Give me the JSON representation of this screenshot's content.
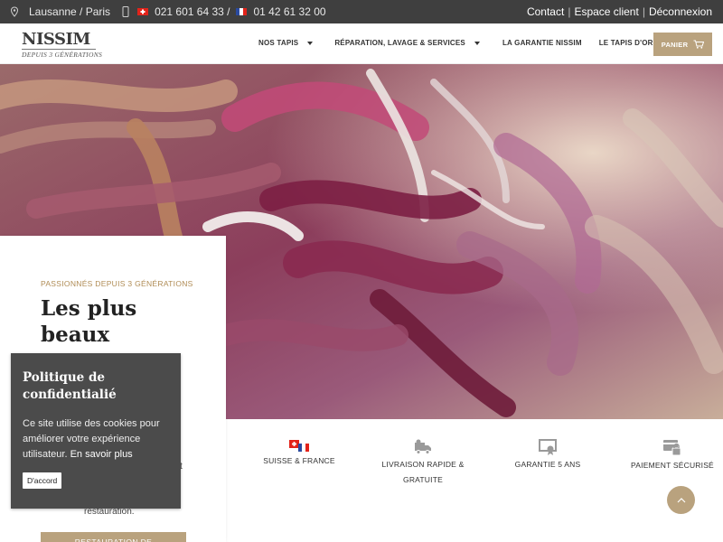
{
  "topbar": {
    "location": "Lausanne / Paris",
    "phone_ch": "021 601 64 33 /",
    "phone_fr": "01 42 61 32 00",
    "links": [
      "Contact",
      "Espace client",
      "Déconnexion"
    ]
  },
  "header": {
    "logo_brand": "NISSIM",
    "logo_sub": "DEPUIS 3 GÉNÉRATIONS",
    "nav": [
      {
        "label": "NOS TAPIS",
        "dropdown": true
      },
      {
        "label": "RÉPARATION, LAVAGE & SERVICES",
        "dropdown": true
      },
      {
        "label": "LA GARANTIE NISSIM",
        "dropdown": false
      },
      {
        "label": "LE TAPIS D'ORIENT",
        "dropdown": true
      }
    ],
    "cart_label": "PANIER"
  },
  "hero_card": {
    "eyebrow": "PASSIONNÉS DEPUIS 3 GÉNÉRATIONS",
    "title": "Les plus beaux",
    "text_fragment_t": "t",
    "text_tail": "restauration.",
    "button_label": "RESTAURATION DE"
  },
  "features": [
    {
      "label": "SUISSE & FRANCE",
      "icon": "swiss-french-flags-icon"
    },
    {
      "label": "LIVRAISON RAPIDE & GRATUITE",
      "icon": "delivery-truck-icon"
    },
    {
      "label": "GARANTIE 5 ANS",
      "icon": "certificate-icon"
    },
    {
      "label": "PAIEMENT SÉCURISÉ",
      "icon": "secure-card-icon"
    }
  ],
  "cookie": {
    "title": "Politique de confidentialié",
    "text": "Ce site utilise des cookies pour améliorer votre expérience utilisateur.",
    "link": "En savoir plus",
    "accept": "D'accord"
  },
  "colors": {
    "accent": "#b9a27e",
    "topbar": "#3f3f3f",
    "cookie_bg": "#4b4b4b",
    "eyebrow": "#b08c55"
  }
}
